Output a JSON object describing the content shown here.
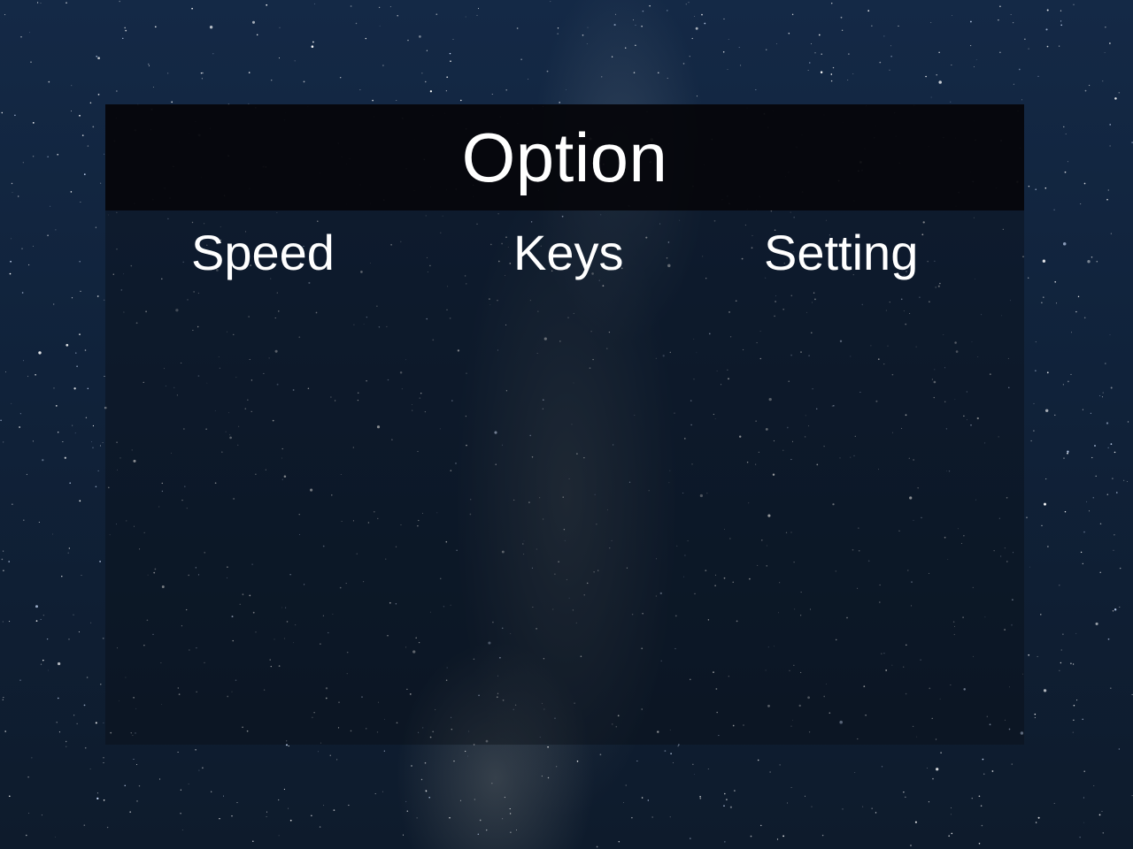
{
  "title": "Option",
  "menu": {
    "items": [
      {
        "label": "Speed"
      },
      {
        "label": "Keys"
      },
      {
        "label": "Setting"
      }
    ]
  },
  "colors": {
    "text": "#ffffff",
    "panel": "#0a0e16",
    "title_bar": "#05060a",
    "sky": "#10223a"
  }
}
